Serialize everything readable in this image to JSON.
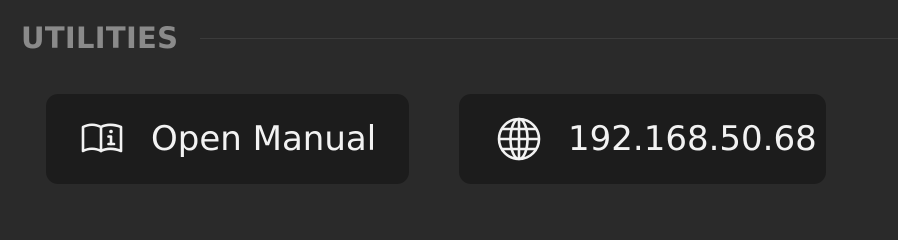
{
  "section": {
    "title": "UTILITIES"
  },
  "buttons": {
    "manual": {
      "label": "Open Manual",
      "icon": "book-info-icon"
    },
    "ip": {
      "label": "192.168.50.68",
      "icon": "globe-icon"
    }
  },
  "colors": {
    "background": "#2a2a2a",
    "button_background": "#1c1c1c",
    "section_title": "#8a8a8a",
    "button_text": "#f2f2f2"
  }
}
